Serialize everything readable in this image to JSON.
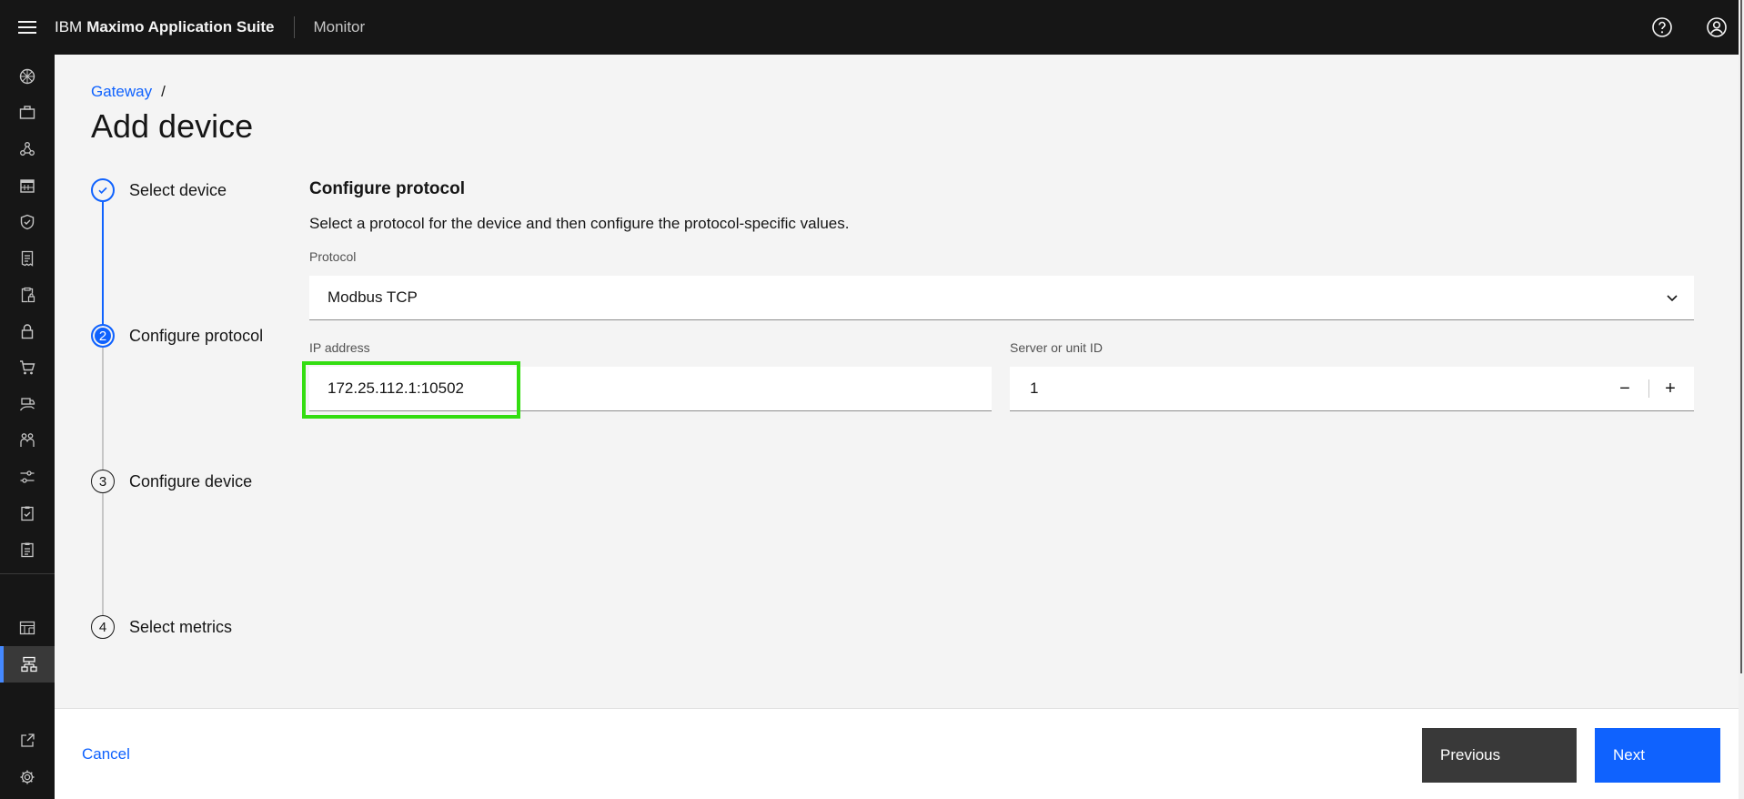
{
  "header": {
    "brand_prefix": "IBM",
    "brand_name": "Maximo Application Suite",
    "app_name": "Monitor",
    "menu_icon": "hamburger-menu-icon",
    "help_icon": "help-icon",
    "user_icon": "user-avatar-icon"
  },
  "rail": {
    "items": [
      "asset-monitor-icon",
      "briefcase-icon",
      "network-nodes-icon",
      "calendar-grid-icon",
      "shield-check-icon",
      "receipt-icon",
      "clipboard-lock-icon",
      "lock-icon",
      "shopping-cart-icon",
      "truck-hand-icon",
      "group-icon",
      "sliders-icon",
      "checklist-icon",
      "clipboard-icon",
      "dashboard-table-icon",
      "hierarchy-icon",
      "launch-icon",
      "settings-icon"
    ],
    "active_item": "hierarchy-icon"
  },
  "breadcrumb": {
    "link": "Gateway",
    "separator": "/"
  },
  "page": {
    "title": "Add device"
  },
  "steps": [
    {
      "number": "1",
      "label": "Select device",
      "state": "complete"
    },
    {
      "number": "2",
      "label": "Configure protocol",
      "state": "current"
    },
    {
      "number": "3",
      "label": "Configure device",
      "state": "incomplete"
    },
    {
      "number": "4",
      "label": "Select metrics",
      "state": "incomplete"
    }
  ],
  "form": {
    "title": "Configure protocol",
    "description": "Select a protocol for the device and then configure the protocol-specific values.",
    "protocol": {
      "label": "Protocol",
      "value": "Modbus TCP"
    },
    "ip_address": {
      "label": "IP address",
      "value": "172.25.112.1:10502"
    },
    "server_id": {
      "label": "Server or unit ID",
      "value": "1",
      "decrement": "−",
      "increment": "+"
    }
  },
  "footer": {
    "cancel": "Cancel",
    "previous": "Previous",
    "next": "Next"
  },
  "colors": {
    "accent": "#0f62fe",
    "header_bg": "#161616",
    "highlight": "#33dd11",
    "secondary_button": "#393939"
  }
}
